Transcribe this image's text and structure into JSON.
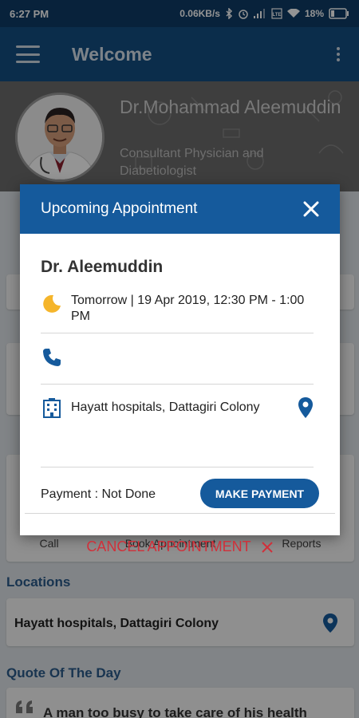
{
  "status_bar": {
    "time": "6:27 PM",
    "net_speed": "0.06KB/s",
    "battery": "18%",
    "icons": [
      "bluetooth-icon",
      "alarm-icon",
      "signal-icon",
      "volte-icon",
      "wifi-icon",
      "battery-icon"
    ]
  },
  "app_bar": {
    "title": "Welcome",
    "icons": [
      "menu-icon",
      "more-vert-icon"
    ]
  },
  "profile": {
    "name": "Dr.Mohammad Aleemuddin",
    "title": "Consultant Physician and Diabetiologist"
  },
  "background": {
    "quick_actions": [
      "Call",
      "Book Appointment",
      "Reports"
    ],
    "locations_title": "Locations",
    "location_name": "Hayatt hospitals, Dattagiri Colony",
    "quote_title": "Quote Of The Day",
    "quote_text": "A man too busy to take care of his health"
  },
  "dialog": {
    "title": "Upcoming Appointment",
    "doctor": "Dr. Aleemuddin",
    "datetime": "Tomorrow | 19 Apr 2019, 12:30 PM - 1:00 PM",
    "location": "Hayatt hospitals, Dattagiri Colony",
    "payment_status": "Payment : Not Done",
    "make_payment_label": "MAKE PAYMENT",
    "cancel_label": "CANCEL APPOINTMENT"
  },
  "colors": {
    "primary": "#155a9c",
    "status_bar": "#0e3b66",
    "danger": "#d0303a"
  }
}
